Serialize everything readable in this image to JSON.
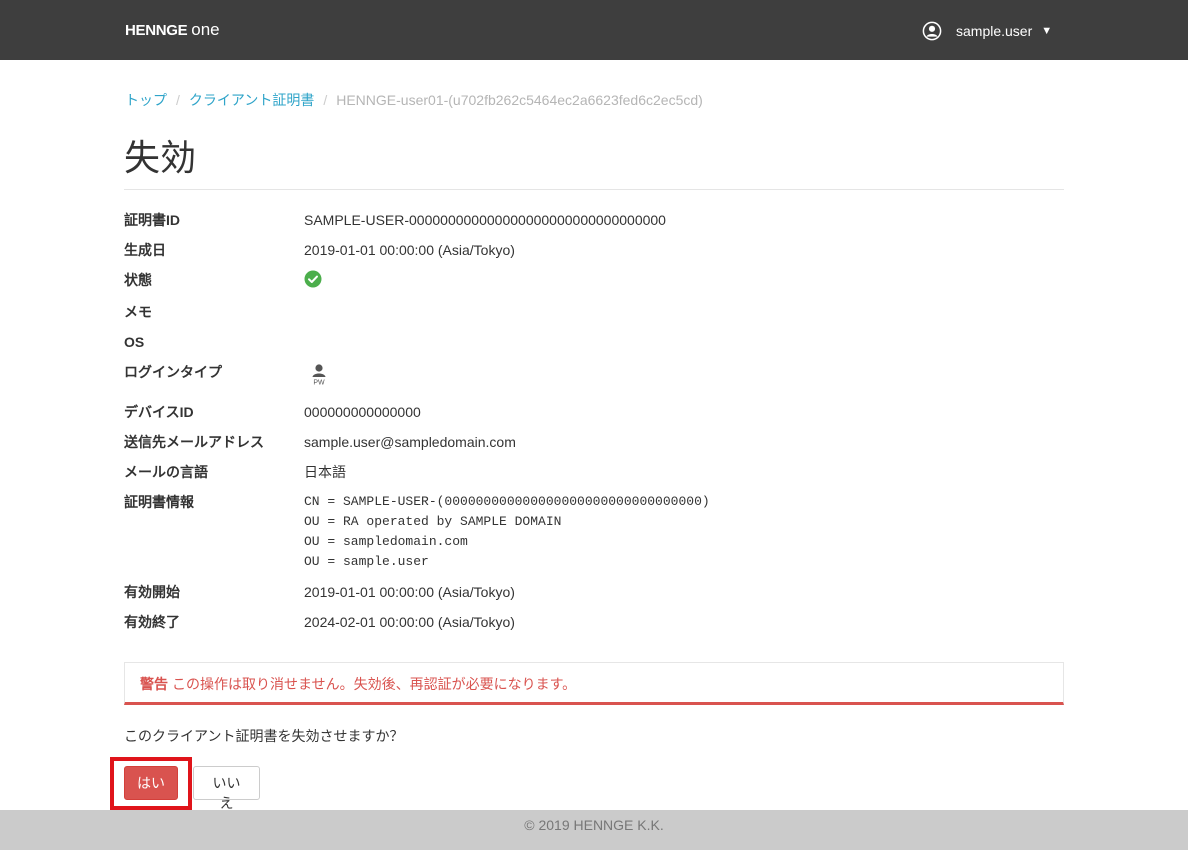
{
  "header": {
    "logo_main": "HENNGE ",
    "logo_sub": "one",
    "username": "sample.user",
    "caret": "▼"
  },
  "breadcrumb": {
    "items": [
      "トップ",
      "クライアント証明書"
    ],
    "separator": "/",
    "current": "HENNGE-user01-(u702fb262c5464ec2a6623fed6c2ec5cd)"
  },
  "page": {
    "title": "失効"
  },
  "details": [
    {
      "label": "証明書ID",
      "value": "SAMPLE-USER-000000000000000000000000000000000"
    },
    {
      "label": "生成日",
      "value": "2019-01-01 00:00:00 (Asia/Tokyo)"
    },
    {
      "label": "状態",
      "value": ""
    },
    {
      "label": "メモ",
      "value": ""
    },
    {
      "label": "OS",
      "value": ""
    },
    {
      "label": "ログインタイプ",
      "value": "PW"
    },
    {
      "label": "デバイスID",
      "value": "000000000000000"
    },
    {
      "label": "送信先メールアドレス",
      "value": "sample.user@sampledomain.com"
    },
    {
      "label": "メールの言語",
      "value": "日本語"
    },
    {
      "label": "証明書情報",
      "lines": [
        "CN = SAMPLE-USER-(000000000000000000000000000000000)",
        "OU = RA operated by SAMPLE DOMAIN",
        "OU = sampledomain.com",
        "OU = sample.user"
      ]
    },
    {
      "label": "有効開始",
      "value": "2019-01-01 00:00:00 (Asia/Tokyo)"
    },
    {
      "label": "有効終了",
      "value": "2024-02-01 00:00:00 (Asia/Tokyo)"
    }
  ],
  "status": {
    "icon": "check-circle-icon",
    "color": "#4cae4c"
  },
  "alert": {
    "label": "警告",
    "message": "この操作は取り消せません。失効後、再認証が必要になります。",
    "color": "#d9534f"
  },
  "confirm": {
    "question": "このクライアント証明書を失効させますか？",
    "yes": "はい",
    "no": "いいえ"
  },
  "footer": {
    "copyright": "© 2019 HENNGE K.K."
  },
  "colors": {
    "topbar": "#3e3e3e",
    "link": "#2fa4c9",
    "danger": "#d9534f",
    "footer": "#cbcbcb",
    "highlight": "#e0141a"
  }
}
